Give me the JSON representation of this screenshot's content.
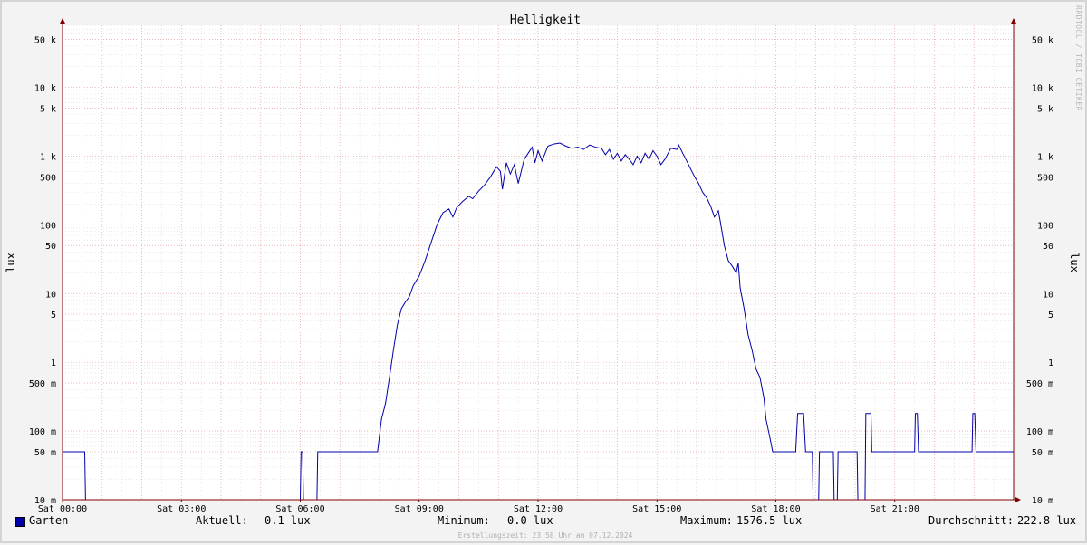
{
  "chart_data": {
    "type": "line",
    "title": "Helligkeit",
    "ylabel": "lux",
    "yscale": "log",
    "ylim": [
      0.01,
      80000
    ],
    "xlim": [
      0,
      24
    ],
    "grid": true,
    "x_ticks": [
      {
        "x": 0,
        "label": "Sat 00:00"
      },
      {
        "x": 3,
        "label": "Sat 03:00"
      },
      {
        "x": 6,
        "label": "Sat 06:00"
      },
      {
        "x": 9,
        "label": "Sat 09:00"
      },
      {
        "x": 12,
        "label": "Sat 12:00"
      },
      {
        "x": 15,
        "label": "Sat 15:00"
      },
      {
        "x": 18,
        "label": "Sat 18:00"
      },
      {
        "x": 21,
        "label": "Sat 21:00"
      }
    ],
    "y_ticks": [
      {
        "y": 0.01,
        "label": "10 m"
      },
      {
        "y": 0.05,
        "label": "50 m"
      },
      {
        "y": 0.1,
        "label": "100 m"
      },
      {
        "y": 0.5,
        "label": "500 m"
      },
      {
        "y": 1,
        "label": "1"
      },
      {
        "y": 5,
        "label": "5"
      },
      {
        "y": 10,
        "label": "10"
      },
      {
        "y": 50,
        "label": "50"
      },
      {
        "y": 100,
        "label": "100"
      },
      {
        "y": 500,
        "label": "500"
      },
      {
        "y": 1000,
        "label": "1 k"
      },
      {
        "y": 5000,
        "label": "5 k"
      },
      {
        "y": 10000,
        "label": "10 k"
      },
      {
        "y": 50000,
        "label": "50 k"
      }
    ],
    "series": [
      {
        "name": "Garten",
        "color": "#0000aa",
        "points": [
          [
            0.0,
            0.05
          ],
          [
            0.56,
            0.05
          ],
          [
            0.58,
            0.01
          ],
          [
            6.0,
            0.01
          ],
          [
            6.02,
            0.05
          ],
          [
            6.06,
            0.05
          ],
          [
            6.08,
            0.01
          ],
          [
            6.42,
            0.01
          ],
          [
            6.44,
            0.05
          ],
          [
            7.95,
            0.05
          ],
          [
            8.05,
            0.15
          ],
          [
            8.15,
            0.25
          ],
          [
            8.25,
            0.6
          ],
          [
            8.35,
            1.5
          ],
          [
            8.45,
            3.5
          ],
          [
            8.55,
            6
          ],
          [
            8.65,
            7.5
          ],
          [
            8.75,
            9
          ],
          [
            8.85,
            13
          ],
          [
            9.0,
            18
          ],
          [
            9.15,
            30
          ],
          [
            9.3,
            55
          ],
          [
            9.45,
            100
          ],
          [
            9.6,
            150
          ],
          [
            9.75,
            170
          ],
          [
            9.85,
            130
          ],
          [
            9.95,
            180
          ],
          [
            10.1,
            220
          ],
          [
            10.25,
            260
          ],
          [
            10.35,
            240
          ],
          [
            10.5,
            310
          ],
          [
            10.65,
            380
          ],
          [
            10.8,
            500
          ],
          [
            10.95,
            700
          ],
          [
            11.05,
            600
          ],
          [
            11.1,
            330
          ],
          [
            11.2,
            800
          ],
          [
            11.3,
            550
          ],
          [
            11.4,
            750
          ],
          [
            11.5,
            400
          ],
          [
            11.65,
            900
          ],
          [
            11.75,
            1100
          ],
          [
            11.85,
            1350
          ],
          [
            11.92,
            800
          ],
          [
            12.0,
            1200
          ],
          [
            12.1,
            850
          ],
          [
            12.25,
            1400
          ],
          [
            12.4,
            1500
          ],
          [
            12.55,
            1550
          ],
          [
            12.7,
            1400
          ],
          [
            12.85,
            1300
          ],
          [
            13.0,
            1350
          ],
          [
            13.15,
            1250
          ],
          [
            13.3,
            1450
          ],
          [
            13.45,
            1350
          ],
          [
            13.6,
            1300
          ],
          [
            13.7,
            1050
          ],
          [
            13.8,
            1250
          ],
          [
            13.9,
            900
          ],
          [
            14.0,
            1100
          ],
          [
            14.1,
            850
          ],
          [
            14.2,
            1050
          ],
          [
            14.3,
            900
          ],
          [
            14.4,
            750
          ],
          [
            14.5,
            1000
          ],
          [
            14.6,
            800
          ],
          [
            14.7,
            1100
          ],
          [
            14.8,
            900
          ],
          [
            14.9,
            1200
          ],
          [
            15.0,
            1000
          ],
          [
            15.1,
            750
          ],
          [
            15.2,
            900
          ],
          [
            15.35,
            1300
          ],
          [
            15.5,
            1250
          ],
          [
            15.55,
            1450
          ],
          [
            15.65,
            1100
          ],
          [
            15.75,
            850
          ],
          [
            15.85,
            650
          ],
          [
            15.95,
            500
          ],
          [
            16.05,
            400
          ],
          [
            16.15,
            300
          ],
          [
            16.25,
            250
          ],
          [
            16.35,
            190
          ],
          [
            16.45,
            130
          ],
          [
            16.55,
            160
          ],
          [
            16.6,
            110
          ],
          [
            16.7,
            50
          ],
          [
            16.8,
            30
          ],
          [
            16.9,
            25
          ],
          [
            17.0,
            20
          ],
          [
            17.05,
            28
          ],
          [
            17.1,
            12
          ],
          [
            17.2,
            6
          ],
          [
            17.3,
            2.5
          ],
          [
            17.4,
            1.5
          ],
          [
            17.5,
            0.8
          ],
          [
            17.6,
            0.6
          ],
          [
            17.7,
            0.3
          ],
          [
            17.75,
            0.15
          ],
          [
            17.85,
            0.08
          ],
          [
            17.92,
            0.05
          ],
          [
            18.5,
            0.05
          ],
          [
            18.55,
            0.18
          ],
          [
            18.7,
            0.18
          ],
          [
            18.75,
            0.05
          ],
          [
            18.92,
            0.05
          ],
          [
            18.94,
            0.01
          ],
          [
            19.08,
            0.01
          ],
          [
            19.1,
            0.05
          ],
          [
            19.45,
            0.05
          ],
          [
            19.47,
            0.01
          ],
          [
            19.55,
            0.01
          ],
          [
            19.57,
            0.05
          ],
          [
            20.05,
            0.05
          ],
          [
            20.07,
            0.01
          ],
          [
            20.25,
            0.01
          ],
          [
            20.27,
            0.18
          ],
          [
            20.4,
            0.18
          ],
          [
            20.42,
            0.05
          ],
          [
            21.5,
            0.05
          ],
          [
            21.52,
            0.18
          ],
          [
            21.57,
            0.18
          ],
          [
            21.6,
            0.05
          ],
          [
            22.95,
            0.05
          ],
          [
            22.97,
            0.18
          ],
          [
            23.02,
            0.18
          ],
          [
            23.05,
            0.05
          ],
          [
            24.0,
            0.05
          ]
        ]
      }
    ],
    "legend": {
      "current_label": "Aktuell:",
      "current_value": "0.1 lux",
      "min_label": "Minimum:",
      "min_value": "0.0 lux",
      "max_label": "Maximum:",
      "max_value": "1576.5 lux",
      "avg_label": "Durchschnitt:",
      "avg_value": "222.8 lux"
    },
    "footer": "Erstellungszeit: 23:58 Uhr am 07.12.2024",
    "watermark": "RRDTOOL / TOBI OETIKER"
  }
}
